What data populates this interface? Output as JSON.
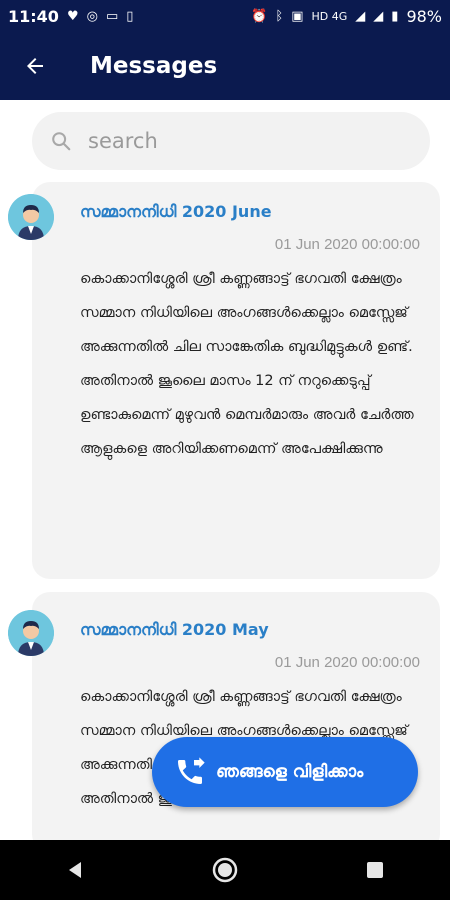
{
  "statusbar": {
    "time": "11:40",
    "network": "HD 4G",
    "battery": "98%"
  },
  "appbar": {
    "title": "Messages"
  },
  "search": {
    "placeholder": "search"
  },
  "messages": [
    {
      "title": "സമ്മാനനിധി 2020 June",
      "date": "01 Jun 2020 00:00:00",
      "body": "കൊക്കാനിശ്ശേരി ശ്രീ കണ്ണങ്ങാട്ട് ഭഗവതി ക്ഷേത്രം സമ്മാന നിധിയിലെ അംഗങ്ങൾക്കെല്ലാം മെസ്സേജ് അക്കുന്നതിൽ ചില സാങ്കേതിക ബുദ്ധിമുട്ടുകൾ ഉണ്ട്. അതിനാൽ ജൂലൈ മാസം 12 ന് നറുക്കെടുപ്പ് ഉണ്ടാകുമെന്ന് മുഴുവൻ മെമ്പർമാരും അവർ ചേർത്ത ആളുകളെ അറിയിക്കണമെന്ന് അപേക്ഷിക്കുന്നു"
    },
    {
      "title": "സമ്മാനനിധി 2020 May",
      "date": "01 Jun 2020 00:00:00",
      "body": "കൊക്കാനിശ്ശേരി ശ്രീ കണ്ണങ്ങാട്ട് ഭഗവതി ക്ഷേത്രം സമ്മാന നിധിയിലെ അംഗങ്ങൾക്കെല്ലാം മെസ്സേജ് അക്കുന്നതിൽ ചില സാങ്കേതിക ബുദ്ധിമുട്ടുകൾ ഉണ്ട്. അതിനാൽ ജൂലൈ"
    }
  ],
  "fab": {
    "label": "ഞങ്ങളെ വിളിക്കാം",
    "icon": "phone-forward-icon"
  },
  "colors": {
    "appbar": "#0b1a4f",
    "accent": "#1f6fe6",
    "title": "#2a7fc7"
  }
}
